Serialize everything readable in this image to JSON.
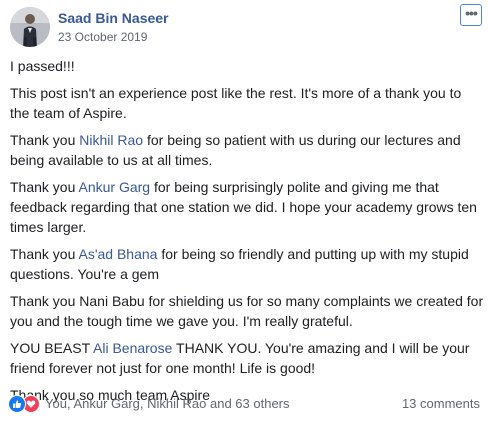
{
  "post": {
    "author": "Saad Bin Naseer",
    "date": "23 October 2019",
    "more_icon": "ellipsis-icon",
    "paragraphs": {
      "p1": "I passed!!!",
      "p2": "This post isn't an experience post like the rest. It's more of a thank you to the team of Aspire.",
      "p3_pre": "Thank you ",
      "p3_tag": "Nikhil Rao",
      "p3_post": " for being so patient with us during our lectures and being available to us at all times.",
      "p4_pre": "Thank you ",
      "p4_tag": "Ankur Garg",
      "p4_post": " for being surprisingly polite and giving me that feedback regarding that one station we did. I hope your academy grows ten times larger.",
      "p5_pre": "Thank you ",
      "p5_tag": "As'ad Bhana",
      "p5_post": " for being so friendly and putting up with my stupid questions. You're a gem",
      "p6": "Thank you Nani Babu for shielding us for so many complaints we created for you and the tough time we gave you. I'm really grateful.",
      "p7_pre": "YOU BEAST ",
      "p7_tag": "Ali Benarose",
      "p7_post": " THANK YOU. You're amazing and I will be your friend forever not just for one month! Life is good!",
      "p8": "Thank you so much team Aspire"
    }
  },
  "footer": {
    "reactions_text": "You, Ankur Garg, Nikhil Rao and 63 others",
    "reaction_icons": [
      "like-icon",
      "love-icon"
    ],
    "comments": "13 comments"
  },
  "colors": {
    "link": "#385898",
    "like": "#1877f2",
    "love": "#f33e58",
    "secondary_text": "#606770"
  }
}
